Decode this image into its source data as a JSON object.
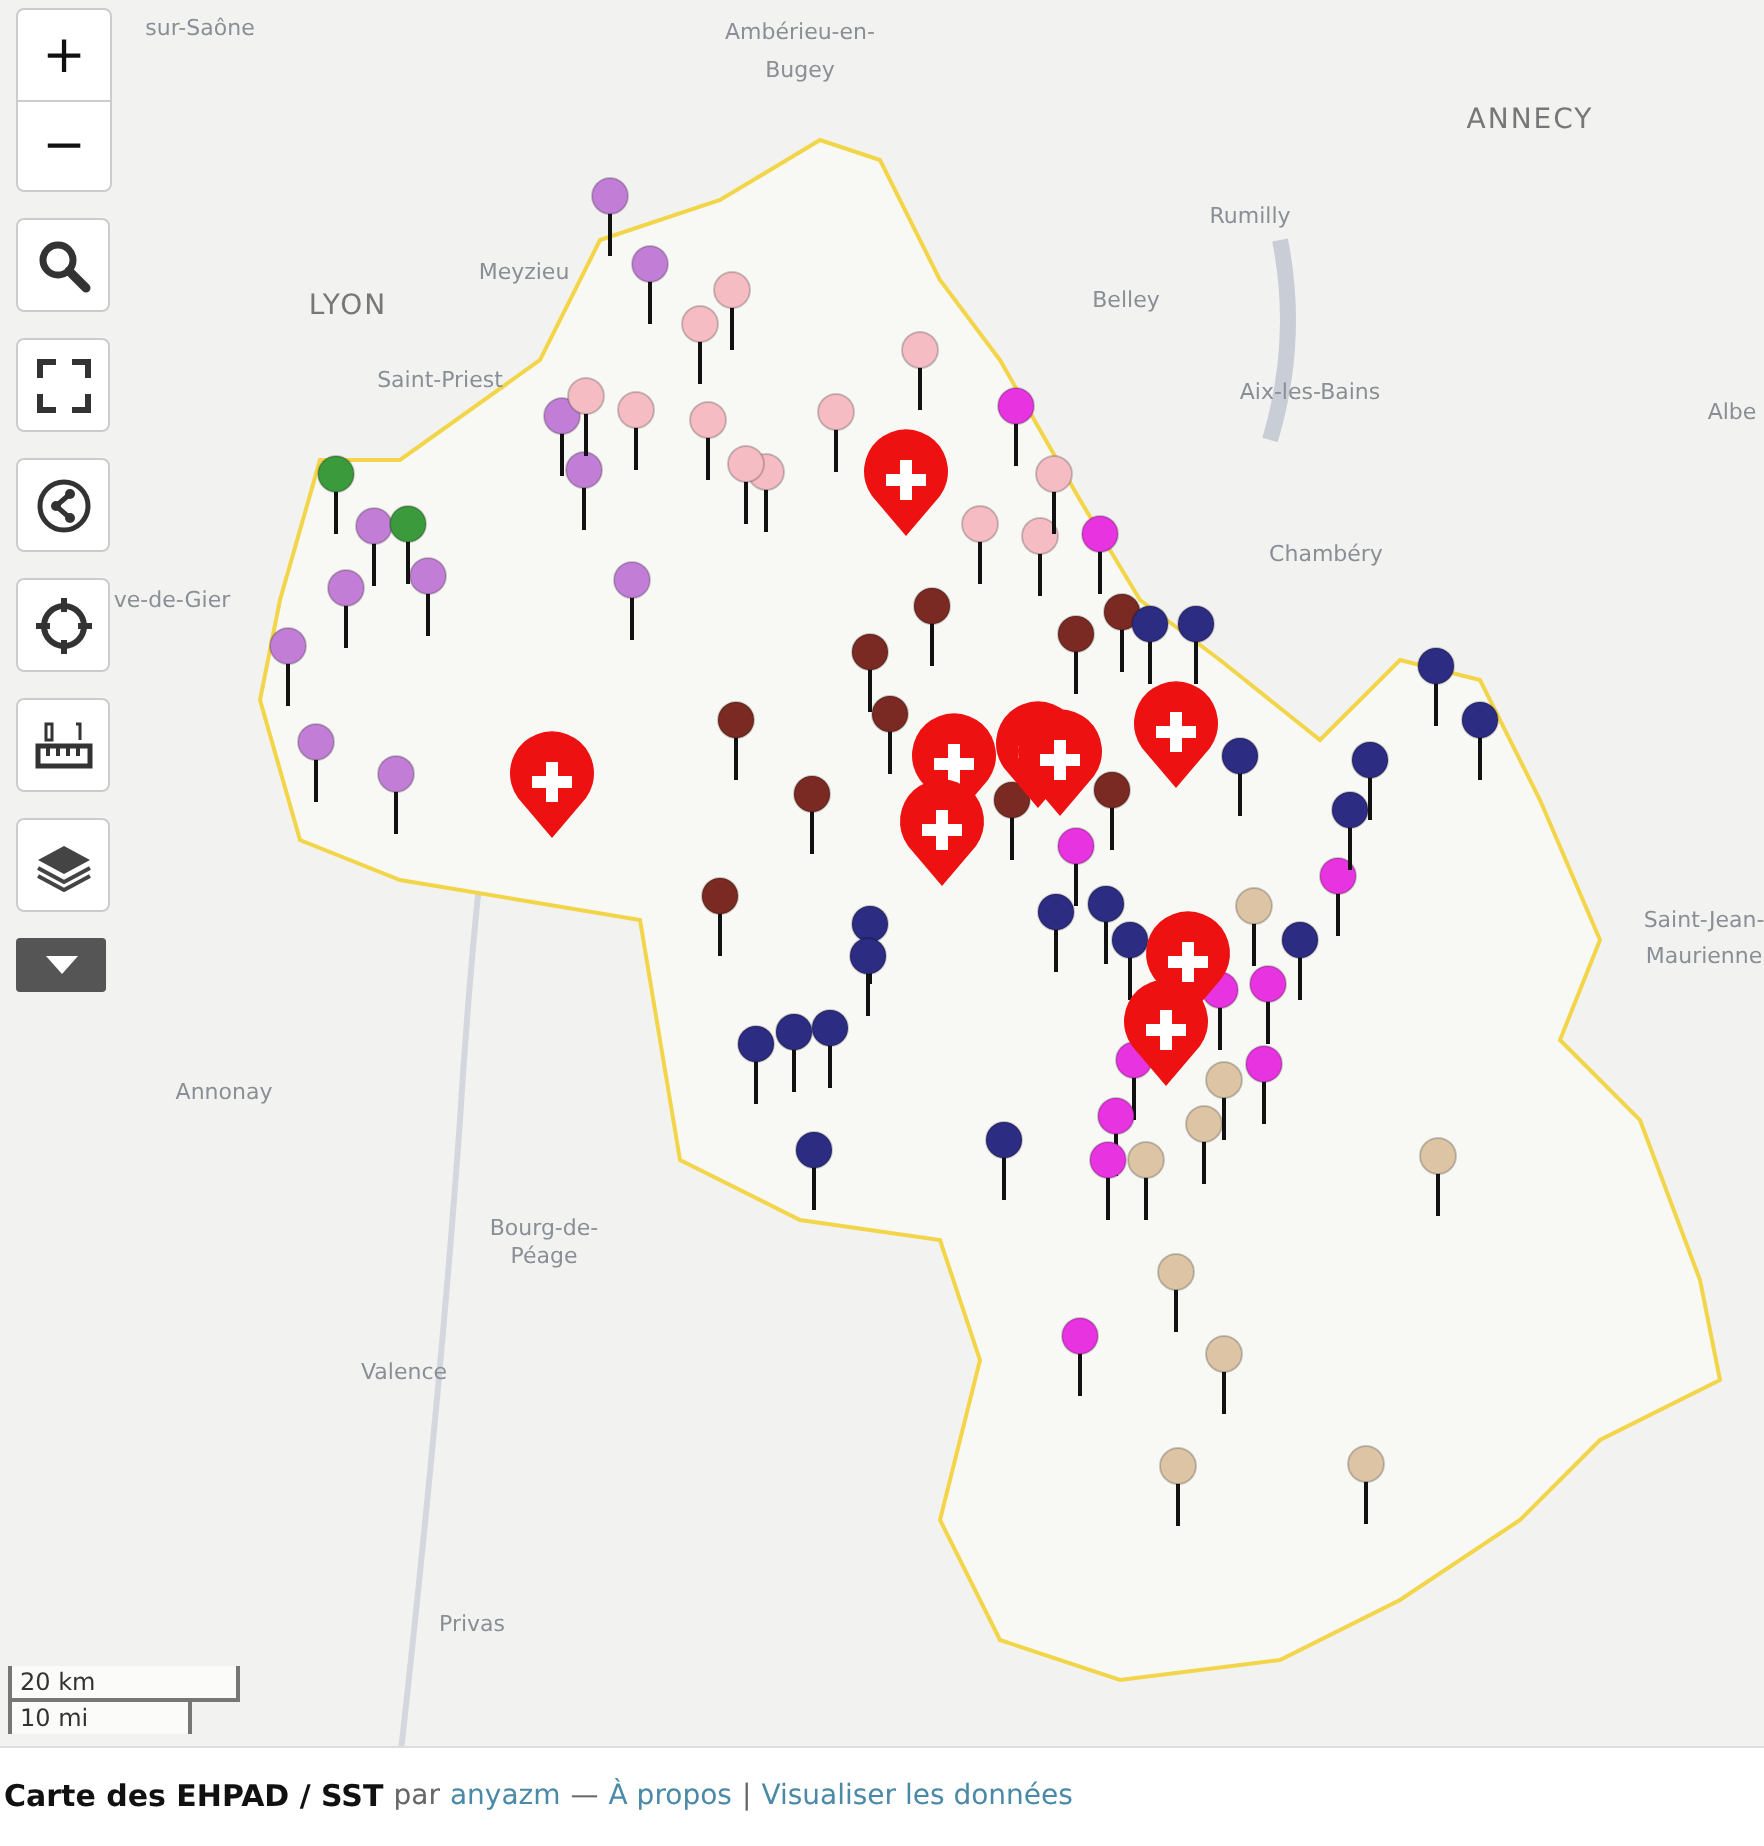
{
  "map": {
    "zoom_in": "+",
    "zoom_out": "−",
    "labels": [
      "sur-Saône",
      "Ambérieu-en-",
      "Bugey",
      "ANNECY",
      "Rumilly",
      "Meyzieu",
      "LYON",
      "Belley",
      "Saint-Priest",
      "Aix-les-Bains",
      "Albe",
      "Chambéry",
      "ve-de-Gier",
      "Saint-Jean-",
      "Maurienne",
      "Annonay",
      "Bourg-de-",
      "Péage",
      "Valence",
      "Privas"
    ],
    "scale": {
      "metric": "20 km",
      "imperial": "10 mi"
    }
  },
  "footer": {
    "title": "Carte des EHPAD / SST",
    "by": "par",
    "author": "anyazm",
    "separator_1": "—",
    "about": "À propos",
    "separator_2": "|",
    "data_link": "Visualiser les données"
  }
}
